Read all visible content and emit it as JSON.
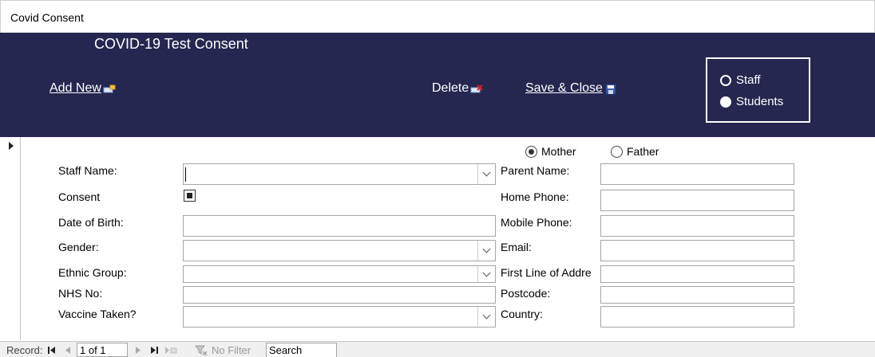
{
  "window": {
    "title": "Covid Consent"
  },
  "header": {
    "form_title": "COVID-19 Test Consent",
    "add_new": "Add New",
    "delete": "Delete",
    "save_close": "Save & Close",
    "group_radio": [
      {
        "label": "Staff",
        "selected": true
      },
      {
        "label": "Students",
        "selected": false
      }
    ]
  },
  "parent_radio": [
    {
      "label": "Mother",
      "selected": true
    },
    {
      "label": "Father",
      "selected": false
    }
  ],
  "left_fields": {
    "staff_name": {
      "label": "Staff Name:",
      "value": ""
    },
    "consent": {
      "label": "Consent",
      "checked": true
    },
    "dob": {
      "label": "Date of Birth:",
      "value": ""
    },
    "gender": {
      "label": "Gender:",
      "value": ""
    },
    "ethnic": {
      "label": "Ethnic Group:",
      "value": ""
    },
    "nhs": {
      "label": "NHS No:",
      "value": ""
    },
    "vaccine": {
      "label": "Vaccine Taken?",
      "value": ""
    }
  },
  "right_fields": {
    "parent_name": {
      "label": "Parent Name:",
      "value": ""
    },
    "home_phone": {
      "label": "Home Phone:",
      "value": ""
    },
    "mobile_phone": {
      "label": "Mobile Phone:",
      "value": ""
    },
    "email": {
      "label": "Email:",
      "value": ""
    },
    "address1": {
      "label": "First Line of Addre",
      "value": ""
    },
    "postcode": {
      "label": "Postcode:",
      "value": ""
    },
    "country": {
      "label": "Country:",
      "value": ""
    }
  },
  "statusbar": {
    "record_label": "Record:",
    "record_value": "1 of 1",
    "filter": "No Filter",
    "search": "Search"
  },
  "colors": {
    "header_bg": "#252750",
    "header_text": "#ffffff"
  }
}
